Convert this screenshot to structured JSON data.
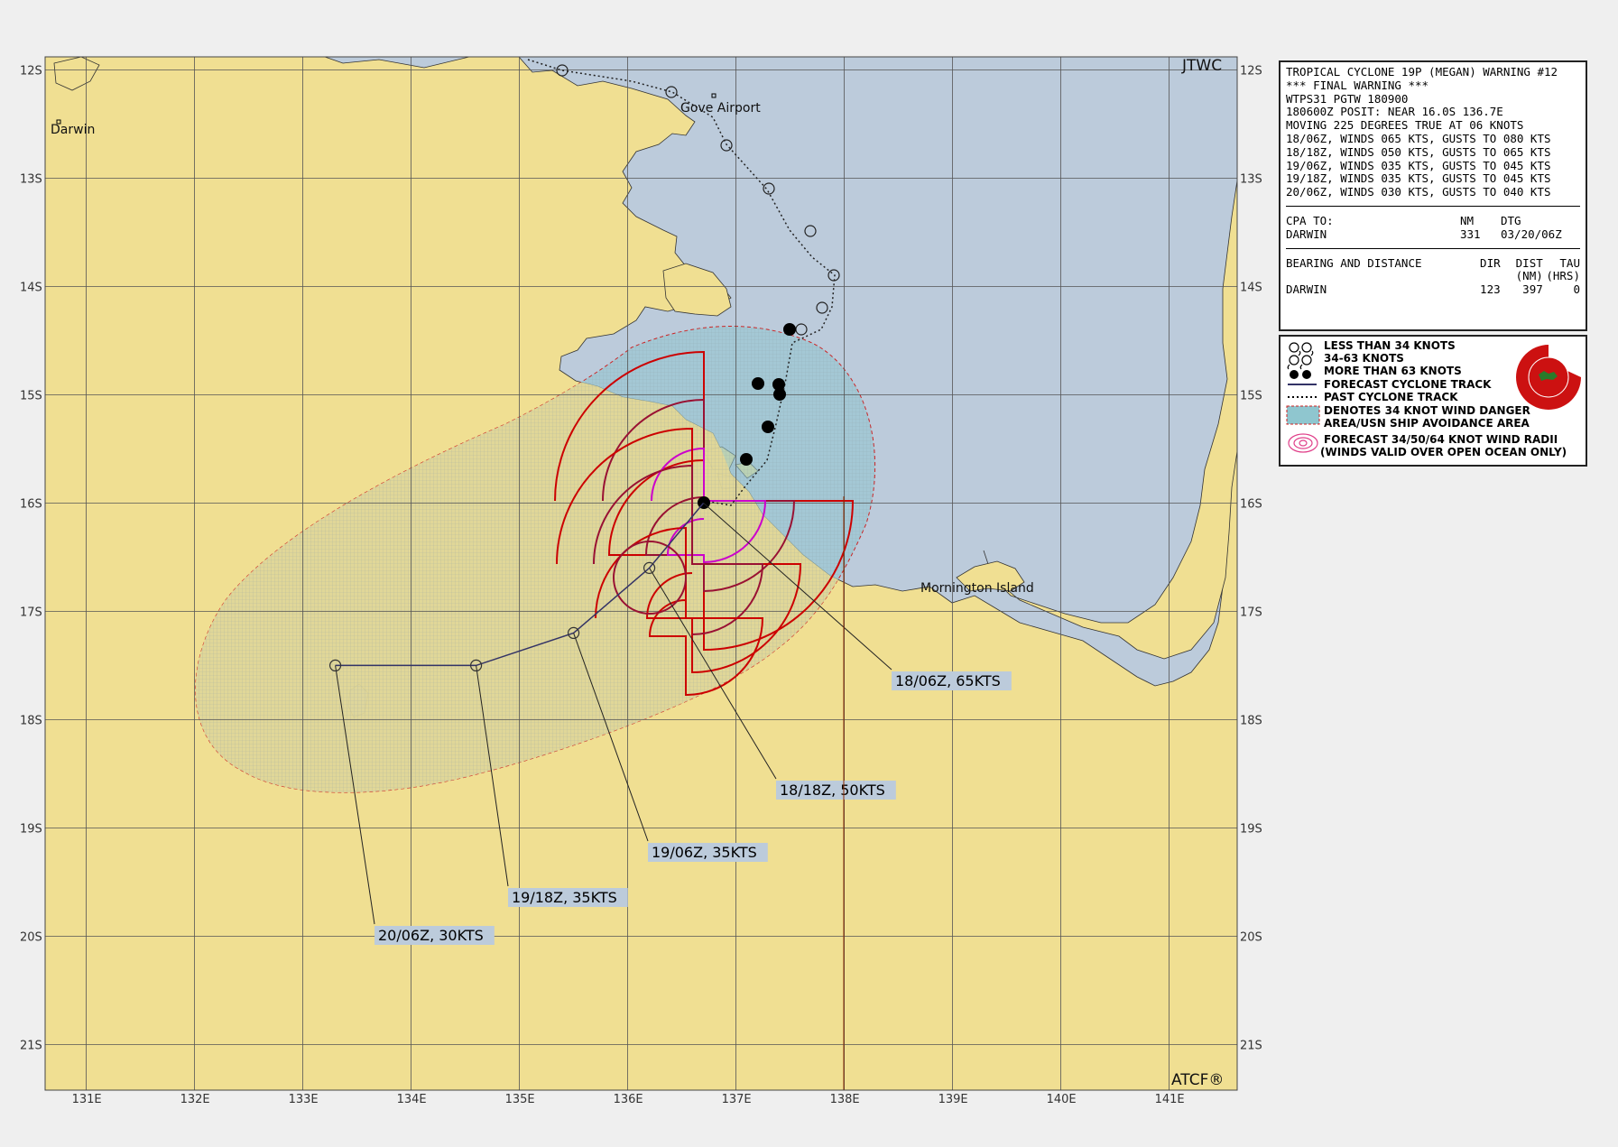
{
  "map": {
    "agency_top": "JTWC",
    "agency_bottom": "ATCF®",
    "lat_labels": [
      "12S",
      "13S",
      "14S",
      "15S",
      "16S",
      "17S",
      "18S",
      "19S",
      "20S",
      "21S"
    ],
    "lon_labels": [
      "131E",
      "132E",
      "133E",
      "134E",
      "135E",
      "136E",
      "137E",
      "138E",
      "139E",
      "140E",
      "141E"
    ],
    "places": {
      "darwin": "Darwin",
      "gove": "Gove Airport",
      "mornington": "Mornington Island"
    },
    "colors": {
      "land": "#f0df92",
      "ocean": "#bccbdb",
      "danger_area": "#8fc6cf",
      "radii_34": "#cc0000",
      "radii_50": "#991133",
      "radii_64": "#cc00cc",
      "track": "#333366"
    }
  },
  "forecast_points": [
    {
      "label": "18/06Z, 65KTS",
      "lat": -16.0,
      "lon": 136.7
    },
    {
      "label": "18/18Z, 50KTS",
      "lat": -16.6,
      "lon": 136.2
    },
    {
      "label": "19/06Z, 35KTS",
      "lat": -17.2,
      "lon": 135.5
    },
    {
      "label": "19/18Z, 35KTS",
      "lat": -17.5,
      "lon": 134.6
    },
    {
      "label": "20/06Z, 30KTS",
      "lat": -17.5,
      "lon": 133.3
    }
  ],
  "warning": {
    "line1": "TROPICAL CYCLONE 19P (MEGAN) WARNING #12",
    "line2": "*** FINAL WARNING ***",
    "line3": "WTPS31 PGTW 180900",
    "line4": "180600Z POSIT: NEAR 16.0S 136.7E",
    "line5": "MOVING 225 DEGREES TRUE AT 06 KNOTS",
    "winds": [
      "18/06Z, WINDS 065 KTS, GUSTS TO 080 KTS",
      "18/18Z, WINDS 050 KTS, GUSTS TO 065 KTS",
      "19/06Z, WINDS 035 KTS, GUSTS TO 045 KTS",
      "19/18Z, WINDS 035 KTS, GUSTS TO 045 KTS",
      "20/06Z, WINDS 030 KTS, GUSTS TO 040 KTS"
    ],
    "cpa": {
      "header_label": "CPA TO:",
      "header_nm": "NM",
      "header_dtg": "DTG",
      "place": "DARWIN",
      "nm": "331",
      "dtg": "03/20/06Z"
    },
    "bearing": {
      "header_label": "BEARING AND DISTANCE",
      "h_dir": "DIR",
      "h_dist": "DIST",
      "h_tau": "TAU",
      "h_nm": "(NM)",
      "h_hrs": "(HRS)",
      "place": "DARWIN",
      "dir": "123",
      "dist": "397",
      "tau": "0"
    }
  },
  "legend": {
    "less34": "LESS THAN 34 KNOTS",
    "k34_63": "34-63 KNOTS",
    "more63": "MORE THAN 63 KNOTS",
    "forecast_track": "FORECAST CYCLONE TRACK",
    "past_track": "PAST CYCLONE TRACK",
    "danger1": "DENOTES 34 KNOT WIND DANGER",
    "danger2": "AREA/USN SHIP AVOIDANCE AREA",
    "radii1": "FORECAST 34/50/64 KNOT WIND RADII",
    "radii2": "(WINDS VALID OVER OPEN OCEAN ONLY)"
  }
}
